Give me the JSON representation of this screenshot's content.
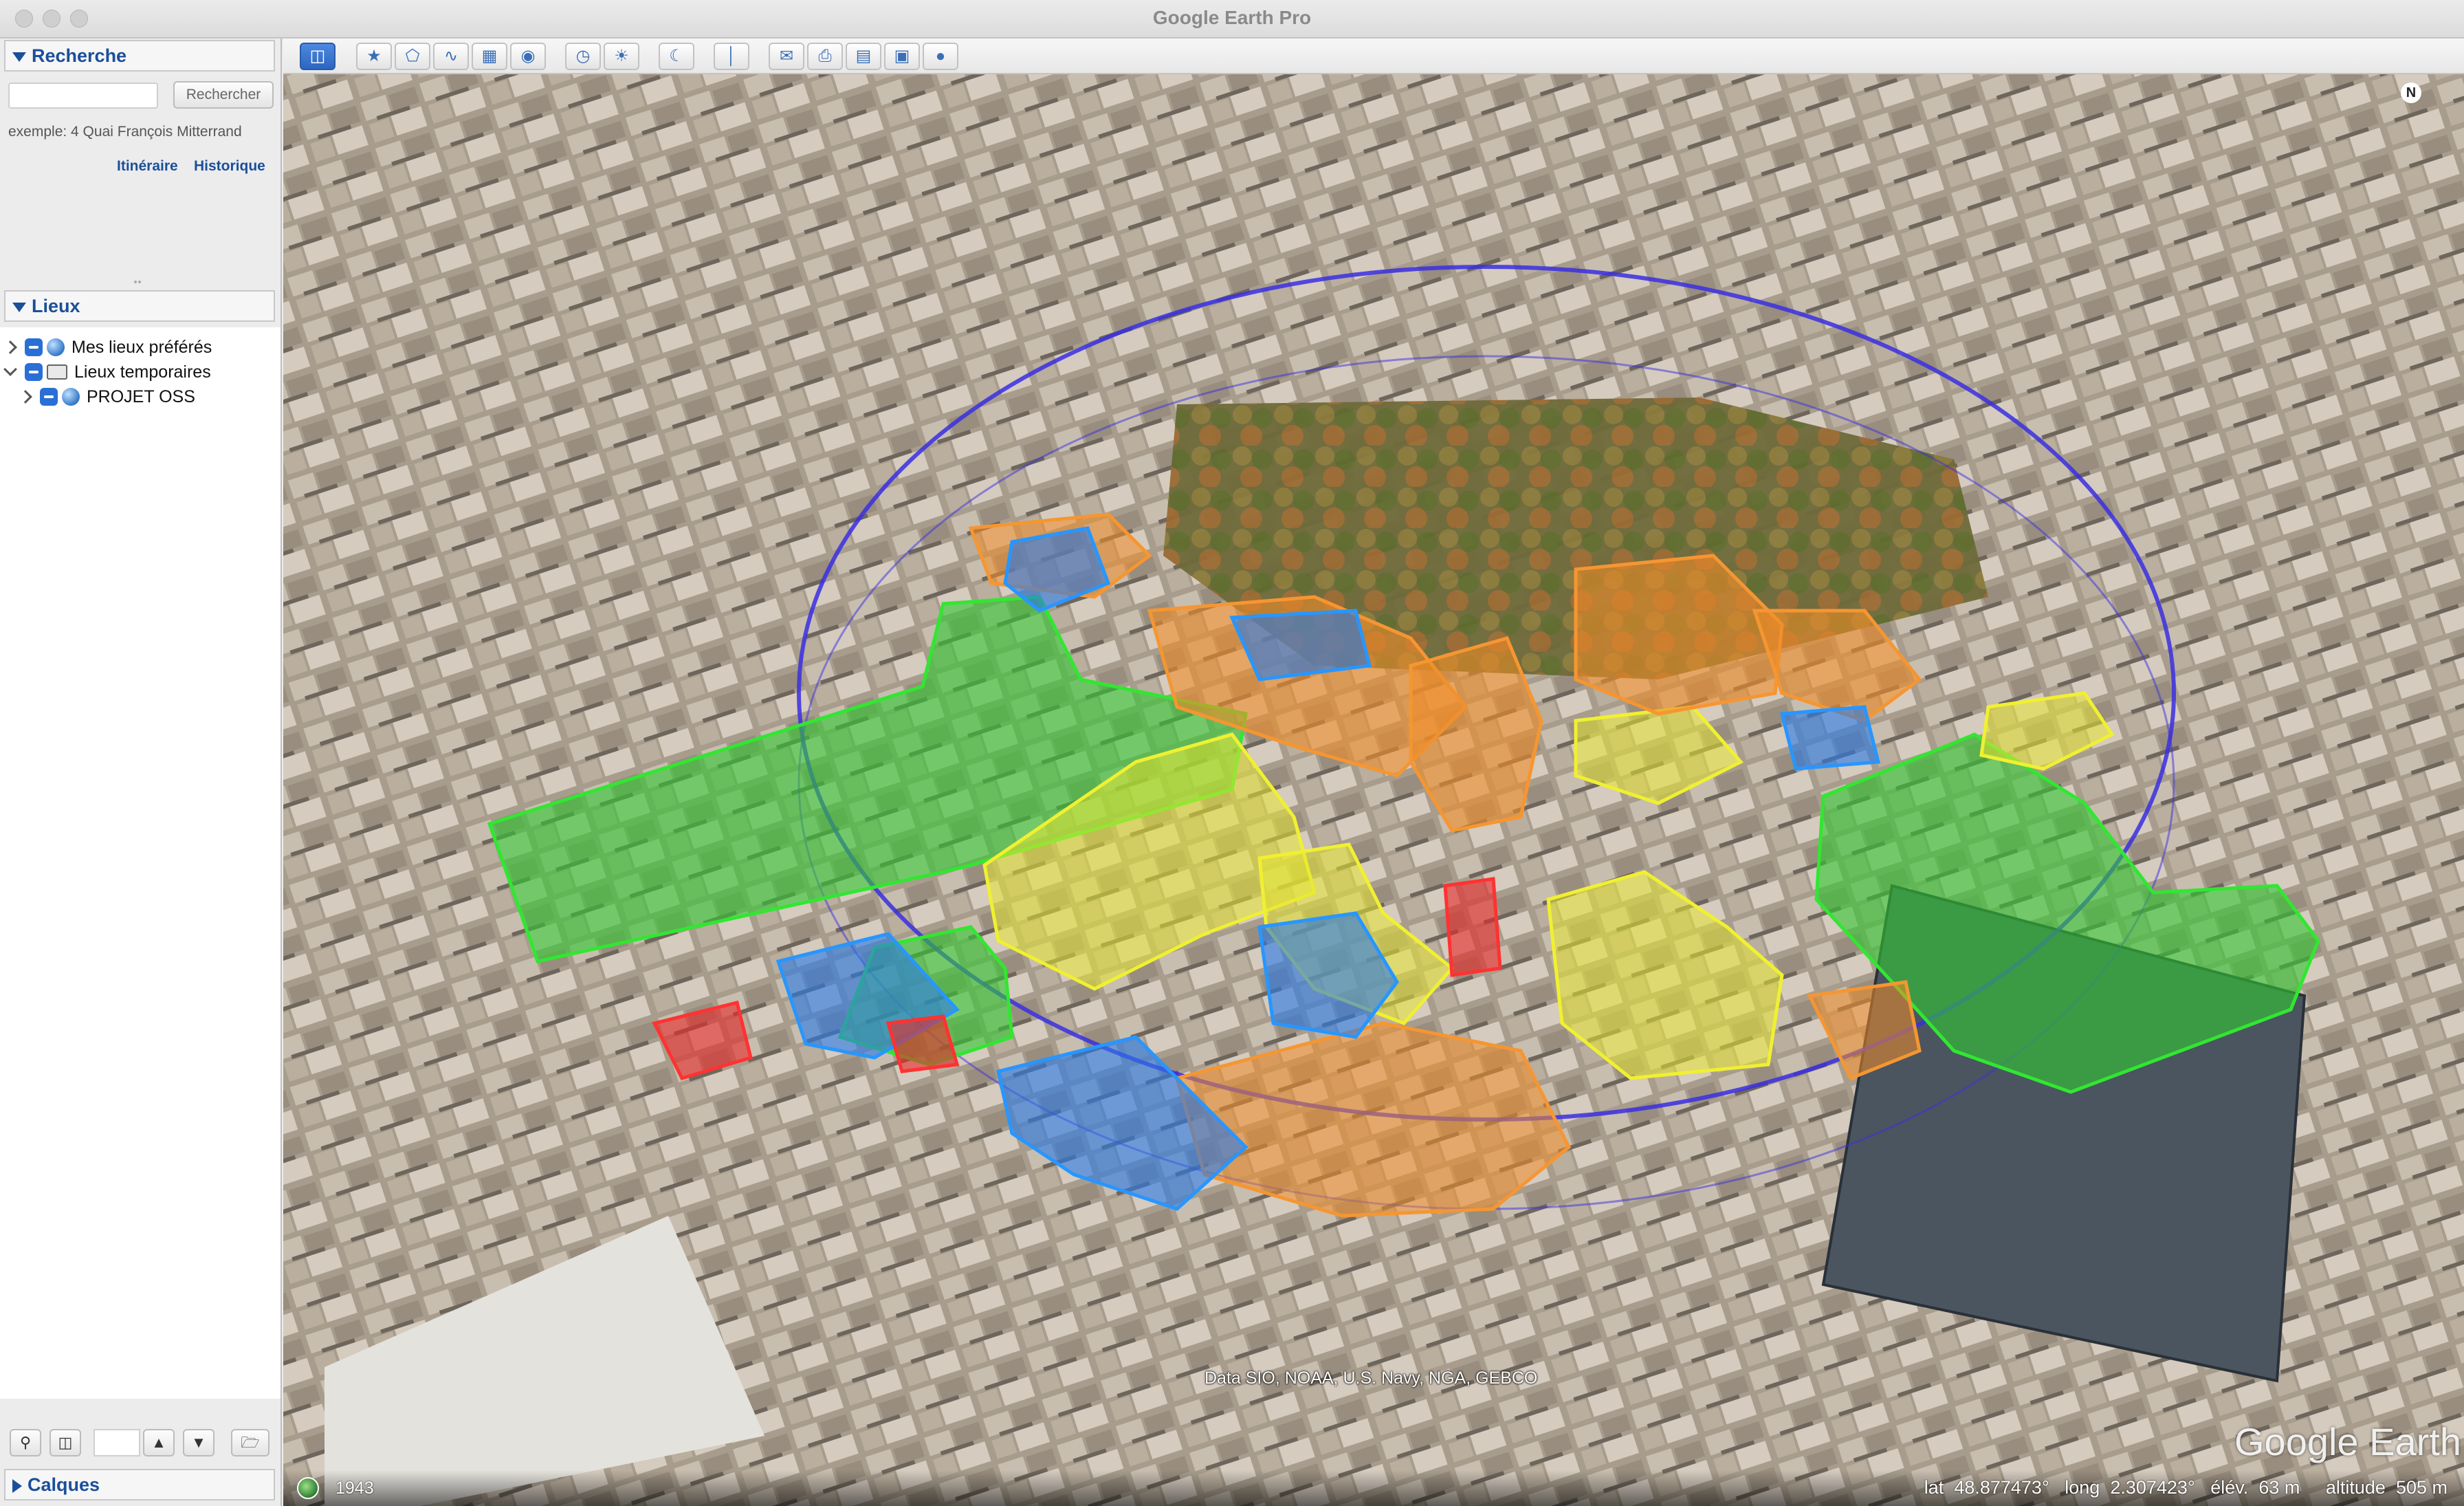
{
  "window": {
    "title": "Google Earth Pro"
  },
  "search": {
    "header": "Recherche",
    "button": "Rechercher",
    "placeholder": "",
    "example": "exemple:  4 Quai François Mitterrand",
    "link_itinerary": "Itinéraire",
    "link_history": "Historique"
  },
  "places": {
    "header": "Lieux",
    "items": [
      {
        "label": "Mes lieux préférés"
      },
      {
        "label": "Lieux temporaires"
      },
      {
        "label": "PROJET OSS"
      }
    ]
  },
  "layers": {
    "header": "Calques"
  },
  "toolbar": {
    "icons": [
      "sidebar-toggle-icon",
      "placemark-icon",
      "polygon-icon",
      "path-icon",
      "image-overlay-icon",
      "tour-icon",
      "historical-imagery-icon",
      "sunlight-icon",
      "planets-icon",
      "ruler-icon",
      "email-icon",
      "print-icon",
      "save-image-icon",
      "maps-icon",
      "globe-icon"
    ]
  },
  "map": {
    "attribution": "Data SIO, NOAA, U.S. Navy, NGA, GEBCO",
    "logo": "Google Earth",
    "north": "N",
    "colors": {
      "green": "#32c832",
      "yellow": "#e6e632",
      "orange": "#f08c28",
      "blue": "#2878e6",
      "red": "#e62828",
      "ring": "#3a2fe0"
    }
  },
  "status": {
    "year": "1943",
    "lat_label": "lat",
    "lat": "48.877473°",
    "long_label": "long",
    "long": "2.307423°",
    "elev_label": "élév.",
    "elev": "63 m",
    "alt_label": "altitude",
    "alt": "505 m"
  }
}
